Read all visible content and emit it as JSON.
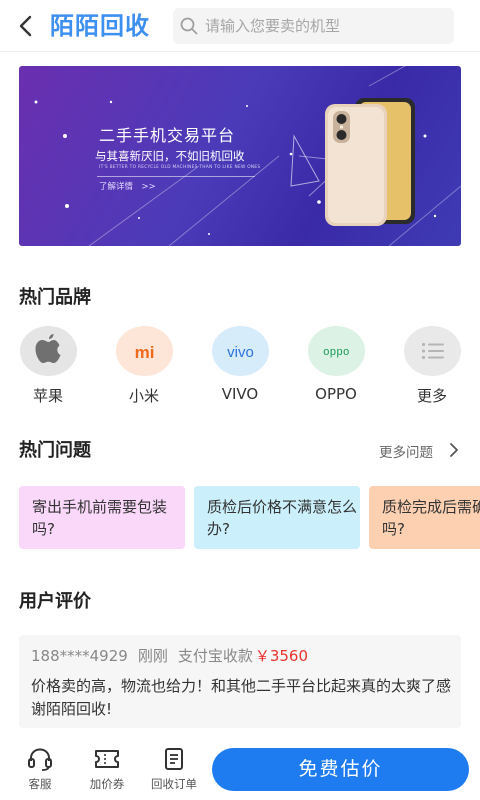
{
  "header": {
    "brand": "陌陌回收",
    "search_placeholder": "请输入您要卖的机型"
  },
  "banner": {
    "title": "二手手机交易平台",
    "subtitle": "与其喜新厌旧，不如旧机回收",
    "english": "IT'S BETTER TO RECYCLE OLD MACHINES THAN TO LIKE NEW ONES",
    "link": "了解详情　>>"
  },
  "brands": {
    "title": "热门品牌",
    "items": [
      {
        "label": "苹果",
        "icon": "apple-icon",
        "bg": "#e5e5e5"
      },
      {
        "label": "小米",
        "icon": "xiaomi-icon",
        "bg": "#fde5d8",
        "logo": "mi"
      },
      {
        "label": "VIVO",
        "icon": "vivo-icon",
        "bg": "#d7ecfb",
        "logo": "vivo"
      },
      {
        "label": "OPPO",
        "icon": "oppo-icon",
        "bg": "#dcf2e5",
        "logo": "oppo"
      },
      {
        "label": "更多",
        "icon": "list-icon",
        "bg": "#e9e9e9"
      }
    ]
  },
  "questions": {
    "title": "热门问题",
    "more": "更多问题",
    "items": [
      {
        "text": "寄出手机前需要包装吗?",
        "bg": "#f9d8f9"
      },
      {
        "text": "质检后价格不满意怎么办?",
        "bg": "#cbf0fb"
      },
      {
        "text": "质检完成后需确认吗?",
        "bg": "#fdd0b2"
      }
    ]
  },
  "reviews": {
    "title": "用户评价",
    "items": [
      {
        "phone": "188****4929",
        "time": "刚刚",
        "method": "支付宝收款",
        "price": "￥3560",
        "text": "价格卖的高，物流也给力！和其他二手平台比起来真的太爽了感谢陌陌回收!"
      }
    ]
  },
  "bottom": {
    "tabs": [
      {
        "label": "客服",
        "icon": "headset-icon"
      },
      {
        "label": "加价券",
        "icon": "coupon-icon"
      },
      {
        "label": "回收订单",
        "icon": "order-icon"
      }
    ],
    "cta": "免费估价"
  },
  "colors": {
    "accent": "#1e7cf0",
    "brand": "#3d8ff0",
    "price": "#e8332e"
  }
}
